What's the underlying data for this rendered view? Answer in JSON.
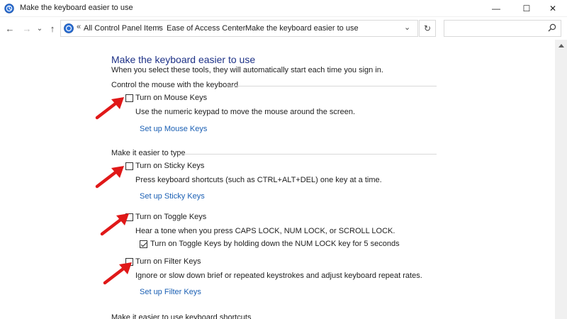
{
  "window": {
    "title": "Make the keyboard easier to use",
    "minimize_glyph": "—",
    "maximize_glyph": "☐",
    "close_glyph": "✕"
  },
  "nav": {
    "back_glyph": "←",
    "forward_glyph": "→",
    "recent_glyph": "⌄",
    "up_glyph": "↑",
    "overflow_glyph": "«",
    "breadcrumbs": [
      "All Control Panel Items",
      "Ease of Access Center",
      "Make the keyboard easier to use"
    ],
    "separator_glyph": "›",
    "dropdown_glyph": "⌄",
    "refresh_glyph": "↻",
    "search_placeholder": ""
  },
  "page": {
    "title": "Make the keyboard easier to use",
    "subtitle": "When you select these tools, they will automatically start each time you sign in."
  },
  "sections": {
    "mouse": {
      "heading": "Control the mouse with the keyboard",
      "mouse_keys": {
        "label": "Turn on Mouse Keys",
        "checked": false,
        "description": "Use the numeric keypad to move the mouse around the screen.",
        "link": "Set up Mouse Keys"
      }
    },
    "typing": {
      "heading": "Make it easier to type",
      "sticky_keys": {
        "label": "Turn on Sticky Keys",
        "checked": false,
        "description": "Press keyboard shortcuts (such as CTRL+ALT+DEL) one key at a time.",
        "link": "Set up Sticky Keys"
      },
      "toggle_keys": {
        "label": "Turn on Toggle Keys",
        "checked": false,
        "description": "Hear a tone when you press CAPS LOCK, NUM LOCK, or SCROLL LOCK.",
        "sub_option_label": "Turn on Toggle Keys by holding down the NUM LOCK key for 5 seconds",
        "sub_option_checked": true
      },
      "filter_keys": {
        "label": "Turn on Filter Keys",
        "checked": false,
        "description": "Ignore or slow down brief or repeated keystrokes and adjust keyboard repeat rates.",
        "link": "Set up Filter Keys"
      }
    },
    "shortcuts": {
      "heading": "Make it easier to use keyboard shortcuts"
    }
  },
  "colors": {
    "title_blue": "#1e3287",
    "link_blue": "#1a5fb4",
    "annotation_red": "#e01818"
  },
  "icons": {
    "app": "ease-of-access-icon",
    "search": "search-icon",
    "annotation": "red-arrow-icon"
  }
}
